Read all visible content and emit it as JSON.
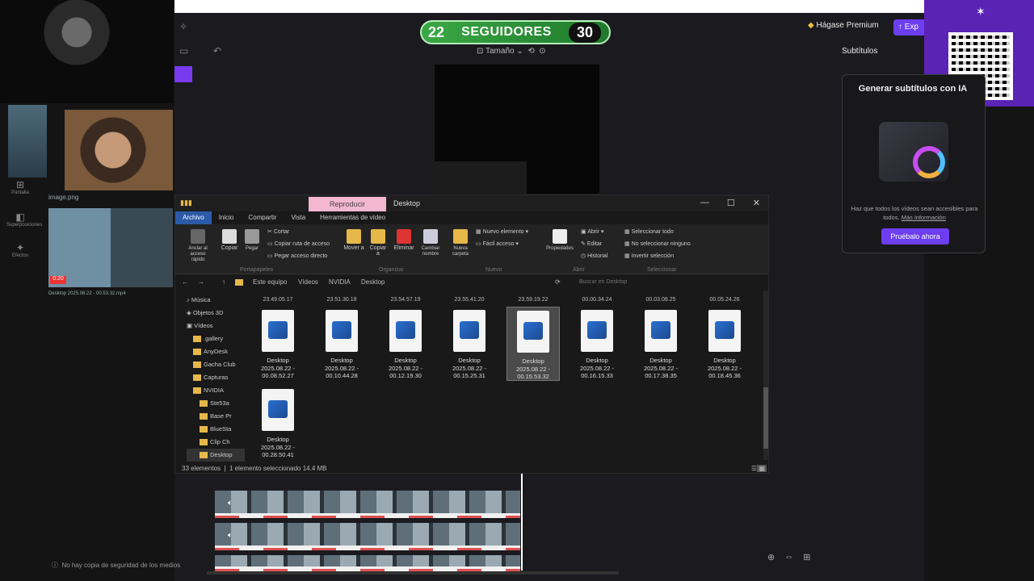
{
  "followers": {
    "current": "22",
    "label": "SEGUIDORES",
    "goal": "30"
  },
  "top": {
    "premium": "Hágase Premium",
    "export": "Exp"
  },
  "preview": {
    "size_label": "Tamaño"
  },
  "subtitles": {
    "title": "Subtítulos",
    "heading": "Generar subtítulos con IA",
    "desc": "Haz que todos los vídeos sean accesibles para todos.",
    "more": "Más información",
    "button": "Pruébalo ahora"
  },
  "webcams": {
    "image_label": "image.png",
    "file_label": "Desktop 2025.08.22 - 00.53.32.mp4",
    "timer": "0:20"
  },
  "explorer": {
    "title": "Desktop",
    "context_tab": "Reproducir",
    "tabs": [
      "Archivo",
      "Inicio",
      "Compartir",
      "Vista",
      "Herramientas de vídeo"
    ],
    "ribbon": {
      "cortar": "Cortar",
      "copiar_ruta": "Copiar ruta de acceso",
      "pegar_acceso": "Pegar acceso directo",
      "anclar": "Anclar al acceso rápido",
      "copiar": "Copiar",
      "pegar": "Pegar",
      "mover": "Mover a",
      "copiar_a": "Copiar a",
      "eliminar": "Eliminar",
      "cambiar_nombre": "Cambiar nombre",
      "nueva_carpeta": "Nueva carpeta",
      "nuevo_elemento": "Nuevo elemento",
      "facil_acceso": "Fácil acceso",
      "propiedades": "Propiedades",
      "abrir": "Abrir",
      "editar": "Editar",
      "historial": "Historial",
      "sel_todo": "Seleccionar todo",
      "no_sel": "No seleccionar ninguno",
      "invertir": "Invertir selección",
      "g_portapapeles": "Portapapeles",
      "g_organizar": "Organizar",
      "g_nuevo": "Nuevo",
      "g_abrir": "Abrir",
      "g_seleccionar": "Seleccionar"
    },
    "breadcrumb": [
      "Este equipo",
      "Vídeos",
      "NVIDIA",
      "Desktop"
    ],
    "search_placeholder": "Buscar en Desktop",
    "nav": [
      "Música",
      "Objetos 3D",
      "Vídeos",
      ".gallery",
      "AnyDesk",
      "Gacha Club",
      "Capturas",
      "NVIDIA",
      "Ste53a",
      "Base Pr",
      "BlueSta",
      "Clip Ch",
      "Desktop"
    ],
    "top_times": [
      "23.49.05.17",
      "23.51.30.18",
      "23.54.57.19",
      "23.55.41.20",
      "23.59.19.22",
      "00.00.34.24",
      "00.03.08.25",
      "00.05.24.26"
    ],
    "files": [
      {
        "name": "Desktop",
        "date": "2025.08.22 -",
        "time": "00.08.52.27"
      },
      {
        "name": "Desktop",
        "date": "2025.08.22 -",
        "time": "00.10.44.28"
      },
      {
        "name": "Desktop",
        "date": "2025.08.22 -",
        "time": "00.12.19.30"
      },
      {
        "name": "Desktop",
        "date": "2025.08.22 -",
        "time": "00.15.25.31"
      },
      {
        "name": "Desktop",
        "date": "2025.08.22 -",
        "time": "00.15.53.32"
      },
      {
        "name": "Desktop",
        "date": "2025.08.22 -",
        "time": "00.16.15.33"
      },
      {
        "name": "Desktop",
        "date": "2025.08.22 -",
        "time": "00.17.38.35"
      },
      {
        "name": "Desktop",
        "date": "2025.08.22 -",
        "time": "00.18.45.36"
      },
      {
        "name": "Desktop",
        "date": "2025.08.22 -",
        "time": "00.28.50.41"
      }
    ],
    "status_count": "33 elementos",
    "status_selected": "1 elemento seleccionado  14.4 MB"
  },
  "rail": {
    "item1": "Pantalla",
    "item2": "Superposiciones",
    "item3": "Efectos"
  },
  "backup": "No hay copia de seguridad de los medios"
}
